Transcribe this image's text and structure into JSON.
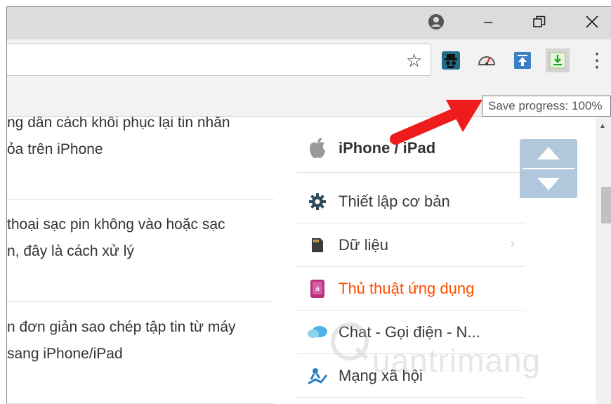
{
  "window": {
    "minimize_label": "–",
    "restore_label": "❐",
    "close_label": "✕"
  },
  "toolbar": {
    "bookmark_star": "☆",
    "menu_dots": "⋮",
    "extensions": [
      "spy-extension-icon",
      "speedometer-extension-icon",
      "upload-extension-icon",
      "download-extension-icon"
    ]
  },
  "tooltip": {
    "text": "Save progress: 100%"
  },
  "articles": [
    {
      "line1": "ng dẫn cách khôi phục lại tin nhắn",
      "line2": "ỏa trên iPhone"
    },
    {
      "line1": " thoại sạc pin không vào hoặc sạc",
      "line2": "n, đây là cách xử lý"
    },
    {
      "line1": "n đơn giản sao chép tập tin từ máy",
      "line2": "sang iPhone/iPad"
    }
  ],
  "menu": {
    "header": "iPhone / iPad",
    "items": [
      {
        "label": "Thiết lập cơ bản",
        "icon": "gear-icon",
        "active": false
      },
      {
        "label": "Dữ liệu",
        "icon": "sd-card-icon",
        "active": false,
        "has_submenu": true
      },
      {
        "label": "Thủ thuật ứng dụng",
        "icon": "app-store-icon",
        "active": true
      },
      {
        "label": "Chat - Gọi điện - N...",
        "icon": "chat-bubble-icon",
        "active": false
      },
      {
        "label": "Mạng xã hội",
        "icon": "social-icon",
        "active": false
      }
    ],
    "active_color": "#ff4f00"
  },
  "watermark": {
    "text": "uantrimang"
  }
}
